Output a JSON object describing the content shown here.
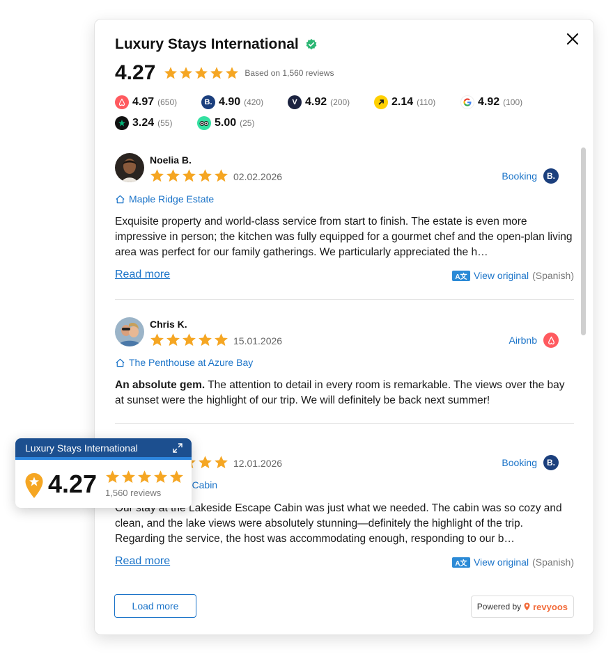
{
  "header": {
    "title": "Luxury Stays International",
    "rating": "4.27",
    "based_on": "Based on 1,560 reviews",
    "stars": 5
  },
  "platforms": [
    {
      "name": "Airbnb",
      "icon": "airbnb-icon",
      "rating": "4.97",
      "count": "(650)",
      "color": "#ff5a5f"
    },
    {
      "name": "Booking",
      "icon": "booking-icon",
      "rating": "4.90",
      "count": "(420)",
      "color": "#1b3f7d"
    },
    {
      "name": "Vrbo",
      "icon": "vrbo-icon",
      "rating": "4.92",
      "count": "(200)",
      "color": "#1c2340"
    },
    {
      "name": "Expedia",
      "icon": "expedia-icon",
      "rating": "2.14",
      "count": "(110)",
      "color": "#ffd000"
    },
    {
      "name": "Google",
      "icon": "google-icon",
      "rating": "4.92",
      "count": "(100)",
      "color": "#ffffff"
    },
    {
      "name": "Trustpilot",
      "icon": "trustpilot-icon",
      "rating": "3.24",
      "count": "(55)",
      "color": "#111111"
    },
    {
      "name": "Tripadvisor",
      "icon": "tripadvisor-icon",
      "rating": "5.00",
      "count": "(25)",
      "color": "#34e0a1"
    }
  ],
  "reviews": [
    {
      "name": "Noelia B.",
      "date": "02.02.2026",
      "stars": 5,
      "source": "Booking",
      "property": "Maple Ridge Estate",
      "bold_lead": "",
      "text": "Exquisite property and world-class service from start to finish. The estate is even more impressive in person; the kitchen was fully equipped for a gourmet chef and the open-plan living area was perfect for our family gatherings. We particularly appreciated the h…",
      "read_more": "Read more",
      "view_original": "View original",
      "language": "(Spanish)"
    },
    {
      "name": "Chris K.",
      "date": "15.01.2026",
      "stars": 5,
      "source": "Airbnb",
      "property": "The Penthouse at Azure Bay",
      "bold_lead": "An absolute gem.",
      "text": " The attention to detail in every room is remarkable. The views over the bay at sunset were the highlight of our trip. We will definitely be back next summer!"
    },
    {
      "name": "",
      "date": "12.01.2026",
      "stars": 5,
      "source": "Booking",
      "property": "Lakeside Escape Cabin",
      "property_visible": "pe Cabin",
      "bold_lead": "",
      "text": "Our stay at the Lakeside Escape Cabin was just what we needed. The cabin was so cozy and clean, and the lake views were absolutely stunning—definitely the highlight of the trip. Regarding the service, the host was accommodating enough, responding to our b…",
      "read_more": "Read more",
      "view_original": "View original",
      "language": "(Spanish)"
    }
  ],
  "footer": {
    "load_more": "Load more",
    "powered_by": "Powered by",
    "brand": "revyoos"
  },
  "badge": {
    "title": "Luxury Stays International",
    "rating": "4.27",
    "count": "1,560 reviews"
  },
  "colors": {
    "accent": "#1a73c8",
    "star": "#f5a623",
    "badge_header": "#1c4f8f"
  }
}
